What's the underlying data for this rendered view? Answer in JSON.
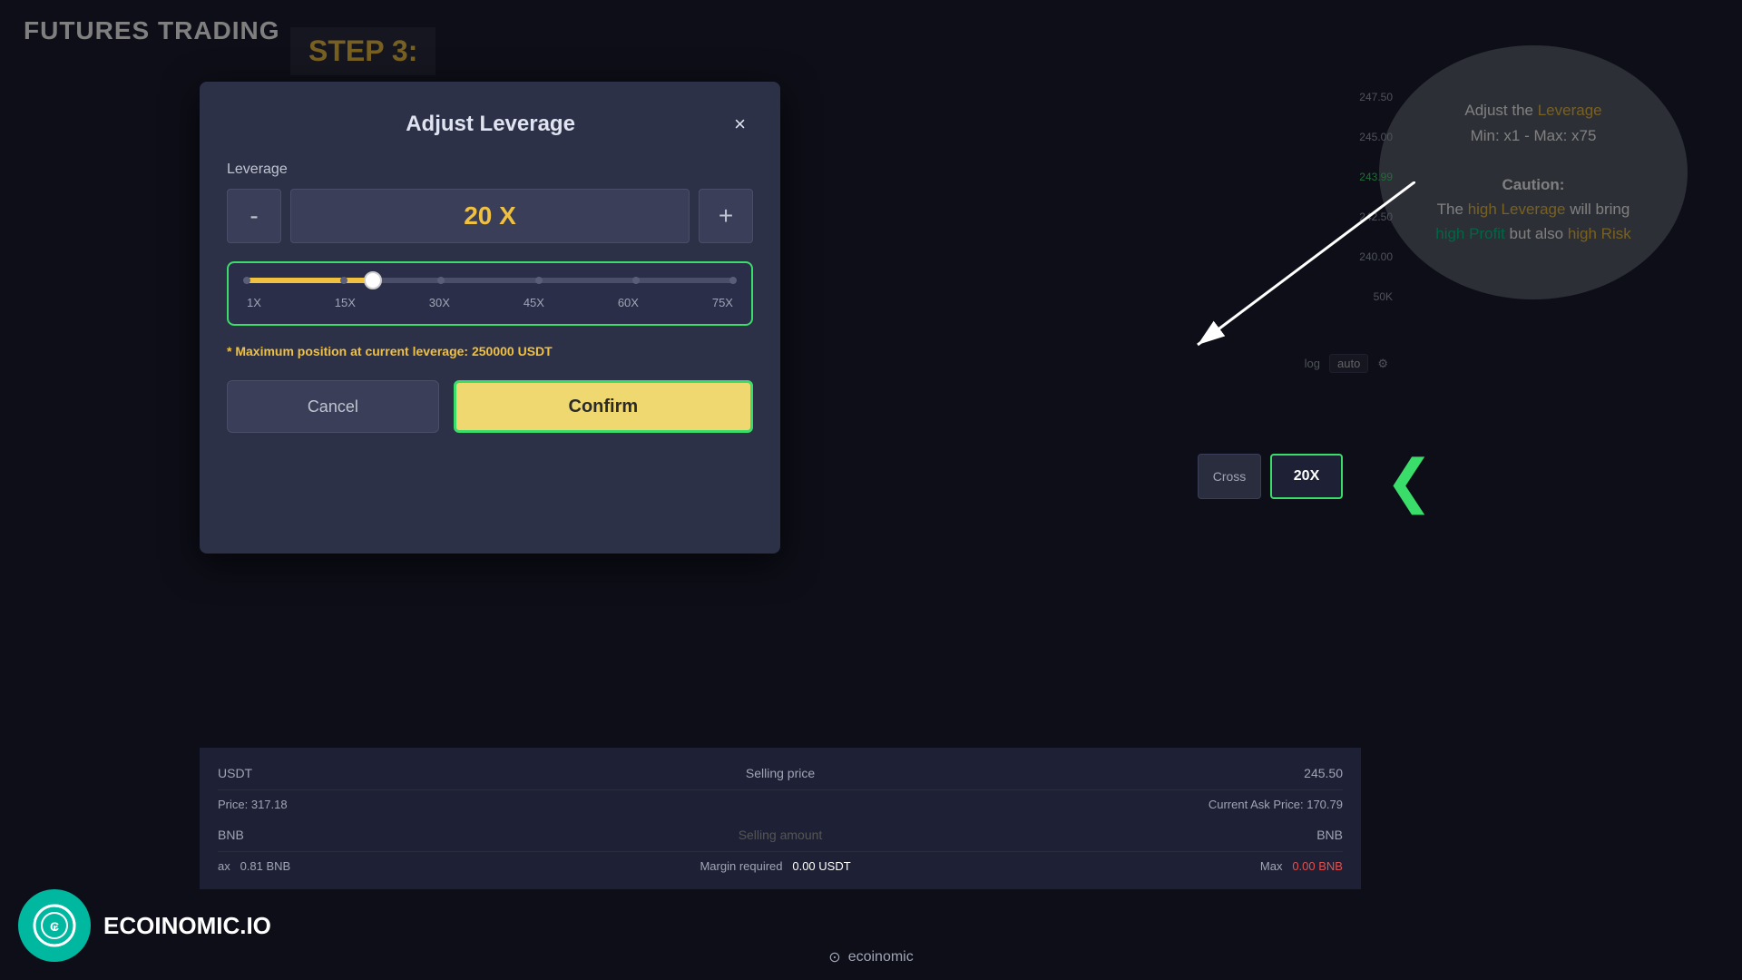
{
  "branding": {
    "title": "FUTURES TRADING",
    "logo_text": "ECOINOMIC.IO",
    "bottom_logo": "⊙ ecoinomic"
  },
  "step": {
    "label": "STEP 3:"
  },
  "info_bubble": {
    "line1": "Adjust the",
    "leverage_highlight": "Leverage",
    "line2": "Min: x1 - Max: x75",
    "caution_label": "Caution:",
    "line3": "The",
    "high_leverage": "high Leverage",
    "line4": "will bring",
    "high_profit": "high Profit",
    "line5": "but also",
    "high_risk": "high Risk"
  },
  "modal": {
    "title": "Adjust Leverage",
    "close_label": "×",
    "leverage_label": "Leverage",
    "leverage_value": "20  X",
    "minus_label": "-",
    "plus_label": "+",
    "slider": {
      "min": 1,
      "max": 75,
      "current": 20,
      "ticks": [
        "1X",
        "15X",
        "30X",
        "45X",
        "60X",
        "75X"
      ]
    },
    "max_position_text": "* Maximum position at current leverage:",
    "max_position_value": "250000",
    "max_position_unit": "USDT",
    "cancel_label": "Cancel",
    "confirm_label": "Confirm"
  },
  "right_panel": {
    "prices": [
      "247.50",
      "245.00",
      "243.99",
      "242.50",
      "240.00",
      "50K"
    ],
    "cross_label": "Cross",
    "leverage_badge": "20X",
    "log_label": "log",
    "auto_label": "auto"
  },
  "bottom_fields": {
    "usdt_label": "USDT",
    "selling_price_label": "Selling price",
    "price_value": "245.50",
    "price_label": "Price: 317.18",
    "current_ask": "Current Ask Price: 170.79",
    "bnb_label": "BNB",
    "selling_amount": "Selling amount",
    "bnb_right": "BNB",
    "margin_label": "Margin required",
    "margin_value": "0.00 USDT",
    "max_label": "ax",
    "max_bnb": "0.81 BNB",
    "max_right": "Max",
    "max_bnb_right": "0.00 BNB"
  },
  "colors": {
    "accent_yellow": "#f0c040",
    "accent_green": "#3adc6a",
    "accent_teal": "#00b8a0",
    "price_green": "#3adc6a",
    "price_red": "#e05050"
  }
}
